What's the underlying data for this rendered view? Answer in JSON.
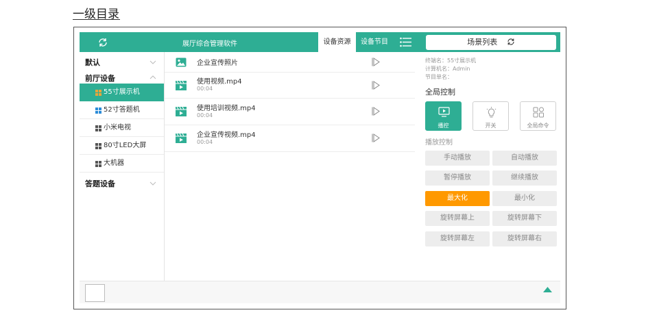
{
  "page_heading": "一级目录",
  "topbar": {
    "title": "展厅综合管理软件",
    "tabs": [
      {
        "label": "设备资源",
        "active": true
      },
      {
        "label": "设备节目",
        "active": false
      }
    ],
    "scene_list_label": "场景列表",
    "accent_color": "#2eae94"
  },
  "sidebar": {
    "groups": [
      {
        "label": "默认",
        "expanded": false
      },
      {
        "label": "前厅设备",
        "expanded": true,
        "devices": [
          "55寸展示机",
          "52寸答题机",
          "小米电视",
          "80寸LED大屏",
          "大机器"
        ],
        "selected": "55寸展示机"
      },
      {
        "label": "答题设备",
        "expanded": false
      }
    ]
  },
  "files": [
    {
      "name": "企业宣传照片",
      "duration": "",
      "icon": "image-icon"
    },
    {
      "name": "使用视频.mp4",
      "duration": "00:04",
      "icon": "video-icon"
    },
    {
      "name": "使用培训视频.mp4",
      "duration": "00:04",
      "icon": "video-icon"
    },
    {
      "name": "企业宣传视频.mp4",
      "duration": "00:04",
      "icon": "video-icon"
    }
  ],
  "device_info": {
    "terminal_name": "终端名：55寸展示机",
    "computer_name": "计算机名：Admin",
    "program_list": "节目单名："
  },
  "global_control": {
    "title": "全局控制",
    "buttons": [
      {
        "label": "播控",
        "icon": "monitor-icon",
        "active": true
      },
      {
        "label": "开关",
        "icon": "bulb-icon",
        "active": false
      },
      {
        "label": "全局命令",
        "icon": "grid-icon",
        "active": false
      }
    ]
  },
  "playback_control": {
    "title": "播放控制",
    "buttons": [
      {
        "label": "手动播放",
        "highlight": false
      },
      {
        "label": "自动播放",
        "highlight": false
      },
      {
        "label": "暂停播放",
        "highlight": false
      },
      {
        "label": "继续播放",
        "highlight": false
      },
      {
        "label": "最大化",
        "highlight": true
      },
      {
        "label": "最小化",
        "highlight": false
      },
      {
        "label": "旋转屏幕上",
        "highlight": false
      },
      {
        "label": "旋转屏幕下",
        "highlight": false
      },
      {
        "label": "旋转屏幕左",
        "highlight": false
      },
      {
        "label": "旋转屏幕右",
        "highlight": false
      }
    ],
    "highlight_color": "#ff9900"
  }
}
